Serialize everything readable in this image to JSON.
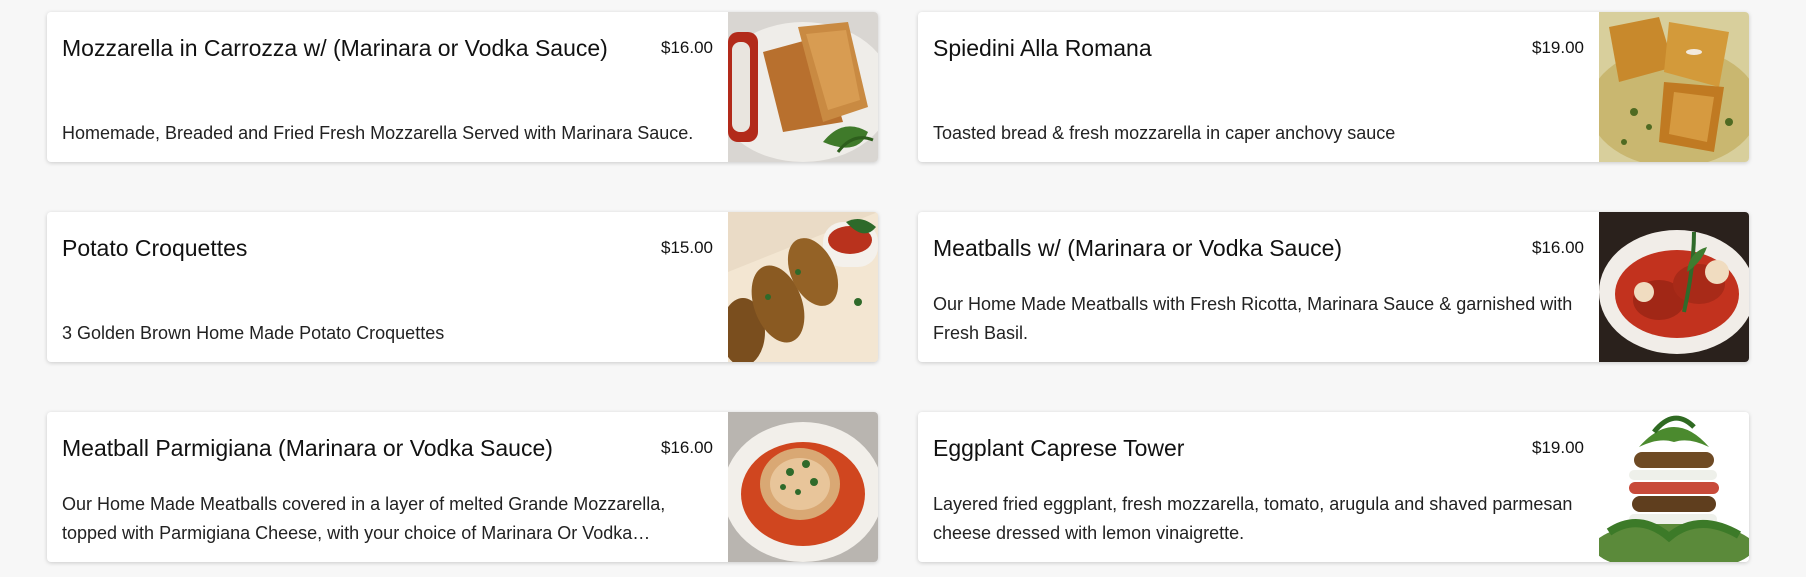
{
  "menu_items": [
    {
      "name": "Mozzarella in Carrozza w/ (Marinara or Vodka Sauce)",
      "price": "$16.00",
      "description": "Homemade, Breaded and Fried Fresh Mozzarella Served with Marinara Sauce.",
      "image": "fried-mozzarella-photo"
    },
    {
      "name": "Spiedini Alla Romana",
      "price": "$19.00",
      "description": "Toasted bread & fresh mozzarella in caper anchovy sauce",
      "image": "spiedini-photo"
    },
    {
      "name": "Potato Croquettes",
      "price": "$15.00",
      "description": "3 Golden Brown Home Made Potato Croquettes",
      "image": "croquettes-photo"
    },
    {
      "name": "Meatballs w/ (Marinara or Vodka Sauce)",
      "price": "$16.00",
      "description": "Our Home Made Meatballs with Fresh Ricotta, Marinara Sauce & garnished with Fresh Basil.",
      "image": "meatballs-photo"
    },
    {
      "name": "Meatball Parmigiana (Marinara or Vodka Sauce)",
      "price": "$16.00",
      "description": "Our Home Made Meatballs covered in a layer of melted Grande Mozzarella, topped with Parmigiana Cheese, with your choice of Marinara Or Vodka…",
      "image": "meatball-parmigiana-photo"
    },
    {
      "name": "Eggplant Caprese Tower",
      "price": "$19.00",
      "description": "Layered fried eggplant, fresh mozzarella, tomato, arugula and shaved parmesan cheese dressed with lemon vinaigrette.",
      "image": "eggplant-tower-photo"
    }
  ]
}
